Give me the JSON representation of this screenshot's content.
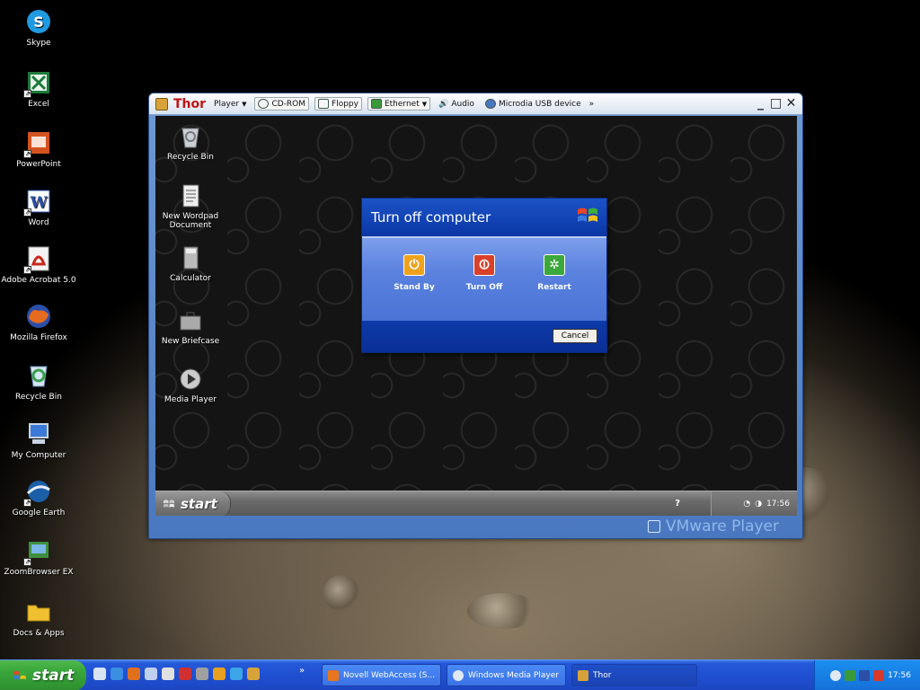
{
  "desktop": {
    "icons": [
      {
        "label": "Skype",
        "icon": "skype-icon",
        "color": "#1f9ae0"
      },
      {
        "label": "Excel",
        "icon": "excel-icon",
        "color": "#1d7a3b"
      },
      {
        "label": "PowerPoint",
        "icon": "powerpoint-icon",
        "color": "#d35320"
      },
      {
        "label": "Word",
        "icon": "word-icon",
        "color": "#2a4fa6"
      },
      {
        "label": "Adobe Acrobat 5.0",
        "icon": "acrobat-icon",
        "color": "#c8271c"
      },
      {
        "label": "Mozilla Firefox",
        "icon": "firefox-icon",
        "color": "#e56b1f"
      },
      {
        "label": "Recycle Bin",
        "icon": "recycle-bin-icon",
        "color": "#4aa36a"
      },
      {
        "label": "My Computer",
        "icon": "my-computer-icon",
        "color": "#3d7ad8"
      },
      {
        "label": "Google Earth",
        "icon": "google-earth-icon",
        "color": "#1b5fa8"
      },
      {
        "label": "ZoomBrowser EX",
        "icon": "zoombrowser-icon",
        "color": "#3f8f3f"
      },
      {
        "label": "Docs & Apps",
        "icon": "folder-icon",
        "color": "#f0c030"
      }
    ]
  },
  "vmware": {
    "title": "Thor",
    "player_menu": "Player",
    "devices": [
      "CD-ROM",
      "Floppy",
      "Ethernet",
      "Audio",
      "Microdia USB device"
    ],
    "overflow": "»",
    "brand": "VMware Player"
  },
  "guest": {
    "icons": [
      {
        "label": "Recycle Bin",
        "icon": "recycle-bin-icon"
      },
      {
        "label": "New Wordpad Document",
        "icon": "wordpad-icon"
      },
      {
        "label": "Calculator",
        "icon": "calculator-icon"
      },
      {
        "label": "New Briefcase",
        "icon": "briefcase-icon"
      },
      {
        "label": "Media Player",
        "icon": "media-player-icon"
      }
    ],
    "start_label": "start",
    "help": "?",
    "clock": "17:56"
  },
  "dialog": {
    "title": "Turn off computer",
    "options": [
      {
        "label": "Stand By",
        "color": "#f0a21c",
        "glyph": "⏻"
      },
      {
        "label": "Turn Off",
        "color": "#d8402a",
        "glyph": "⏼"
      },
      {
        "label": "Restart",
        "color": "#3aa83a",
        "glyph": "✲"
      }
    ],
    "cancel": "Cancel"
  },
  "taskbar": {
    "start_label": "start",
    "quick_launch_colors": [
      "#d8e4f4",
      "#3a8fe0",
      "#e0701e",
      "#c0d0f0",
      "#e0e0e0",
      "#d03030",
      "#a0a0a0",
      "#e8a020",
      "#3ca4e8",
      "#d8a23a"
    ],
    "more": "»",
    "tasks": [
      {
        "label": "Novell WebAccess (S...",
        "icon_color": "#e8741c"
      },
      {
        "label": "Windows Media Player",
        "icon_color": "#e0e8f4"
      },
      {
        "label": "Thor",
        "icon_color": "#d8a23a"
      }
    ],
    "clock": "17:56"
  }
}
